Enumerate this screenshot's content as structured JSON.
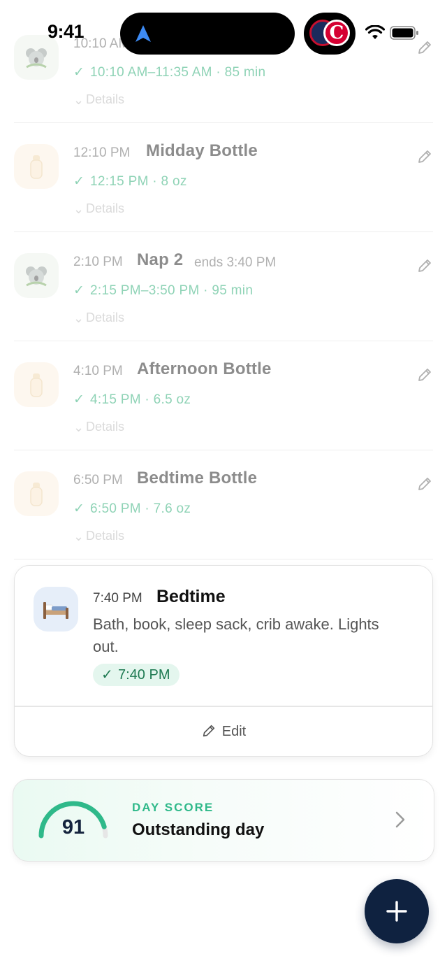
{
  "status_bar": {
    "time": "9:41",
    "live_activity_logo": "C"
  },
  "timeline": {
    "rows": [
      {
        "icon": "koala",
        "time": "10:10 AM",
        "title": "",
        "ends": "",
        "actual": "10:10 AM–11:35 AM · 85 min",
        "details": "Details"
      },
      {
        "icon": "bottle",
        "time": "12:10 PM",
        "title": "Midday Bottle",
        "ends": "",
        "actual": "12:15 PM · 8 oz",
        "details": "Details"
      },
      {
        "icon": "koala",
        "time": "2:10 PM",
        "title": "Nap 2",
        "ends": "ends 3:40 PM",
        "actual": "2:15 PM–3:50 PM · 95 min",
        "details": "Details"
      },
      {
        "icon": "bottle",
        "time": "4:10 PM",
        "title": "Afternoon Bottle",
        "ends": "",
        "actual": "4:15 PM · 6.5 oz",
        "details": "Details"
      },
      {
        "icon": "bottle",
        "time": "6:50 PM",
        "title": "Bedtime Bottle",
        "ends": "",
        "actual": "6:50 PM · 7.6 oz",
        "details": "Details"
      }
    ]
  },
  "bedtime_card": {
    "time": "7:40 PM",
    "title": "Bedtime",
    "description": "Bath, book, sleep sack, crib awake. Lights out.",
    "completed_time": "7:40 PM",
    "edit_label": "Edit"
  },
  "day_score": {
    "score": "91",
    "score_value": 91,
    "score_max": 100,
    "label": "DAY SCORE",
    "rating": "Outstanding day",
    "accent_color": "#2fb98a"
  },
  "fab": {
    "icon": "plus-icon"
  },
  "colors": {
    "check_green": "#8fd3b6",
    "fab_navy": "#0f2240",
    "pill_bg": "#e4f6ee"
  }
}
